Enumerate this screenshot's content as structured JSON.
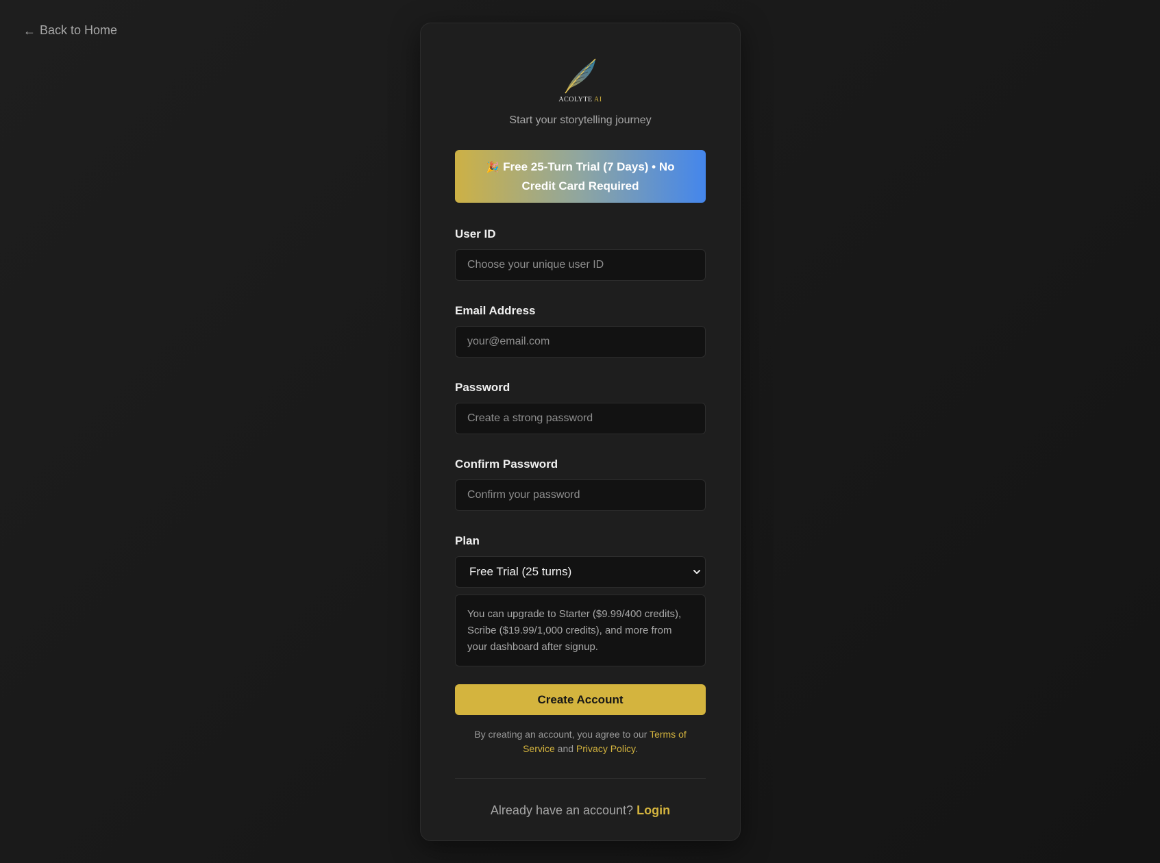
{
  "nav": {
    "back_arrow_icon": "arrow-left-icon",
    "back_label": "Back to Home"
  },
  "brand": {
    "logo_icon": "feather-quill-icon",
    "name": "ACOLYTE",
    "name_suffix": "AI",
    "tagline": "Start your storytelling journey"
  },
  "banner": {
    "icon": "party-popper-icon",
    "emoji": "🎉",
    "text": "Free 25-Turn Trial (7 Days) • No Credit Card Required"
  },
  "form": {
    "user_id": {
      "label": "User ID",
      "placeholder": "Choose your unique user ID",
      "value": ""
    },
    "email": {
      "label": "Email Address",
      "placeholder": "your@email.com",
      "value": ""
    },
    "password": {
      "label": "Password",
      "placeholder": "Create a strong password",
      "value": ""
    },
    "confirm_password": {
      "label": "Confirm Password",
      "placeholder": "Confirm your password",
      "value": ""
    },
    "plan": {
      "label": "Plan",
      "selected": "Free Trial (25 turns)",
      "chevron_icon": "chevron-down-icon"
    },
    "plan_info": "You can upgrade to Starter ($9.99/400 credits), Scribe ($19.99/1,000 credits), and more from your dashboard after signup.",
    "submit_label": "Create Account"
  },
  "terms": {
    "prefix": "By creating an account, you agree to our",
    "terms_link": "Terms of Service",
    "joiner": "and",
    "privacy_link": "Privacy Policy",
    "suffix": "."
  },
  "footer": {
    "prompt": "Already have an account?",
    "login_link": "Login"
  },
  "colors": {
    "accent": "#d4b43e",
    "banner_start": "#cdb145",
    "banner_end": "#4486ec",
    "background": "#181818",
    "card": "#1e1e1e"
  }
}
